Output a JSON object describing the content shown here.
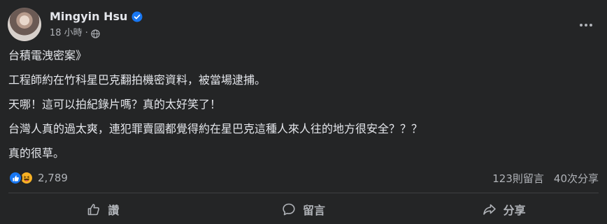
{
  "post": {
    "author": {
      "name": "Mingyin Hsu"
    },
    "meta": {
      "time": "18 小時",
      "separator": "·"
    },
    "content": [
      "台積電洩密案》",
      "工程師約在竹科星巴克翻拍機密資料，被當場逮捕。",
      "天哪！這可以拍紀錄片嗎？真的太好笑了！",
      "台灣人真的過太爽，連犯罪賣國都覺得約在星巴克這種人來人往的地方很安全？？？",
      "真的很草。"
    ],
    "stats": {
      "reactions_count": "2,789",
      "comments": "123則留言",
      "shares": "40次分享"
    },
    "actions": {
      "like_label": "讚",
      "comment_label": "留言",
      "share_label": "分享"
    },
    "icons": {
      "verified": "verified-badge-icon",
      "privacy": "globe-icon",
      "more": "more-horizontal-icon",
      "reaction_1": "like-reaction-icon",
      "reaction_2": "haha-reaction-icon",
      "like": "thumbs-up-icon",
      "comment": "comment-bubble-icon",
      "share": "share-arrow-icon"
    },
    "colors": {
      "background": "#242526",
      "text_primary": "#e4e6eb",
      "text_secondary": "#b0b3b8",
      "verified_blue": "#1877f2",
      "like_blue": "#1877f2",
      "haha_yellow": "#f7b125",
      "divider": "#3e4042"
    }
  }
}
